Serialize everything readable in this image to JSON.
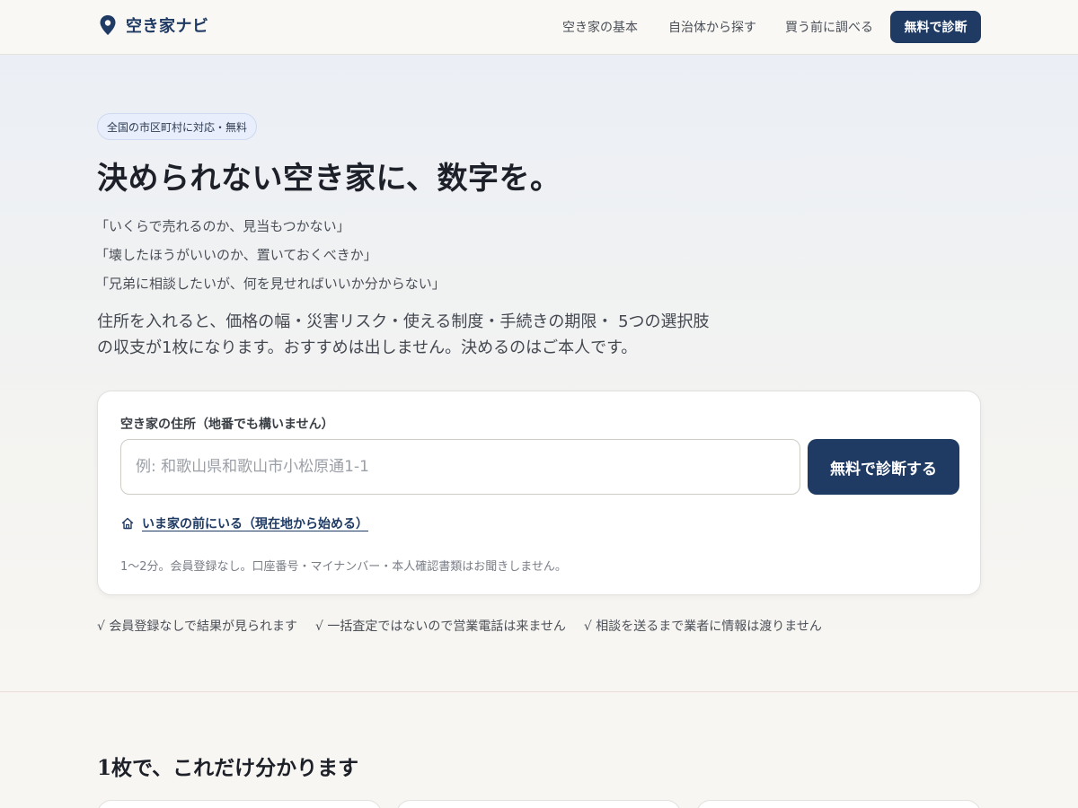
{
  "header": {
    "logo_text": "空き家ナビ",
    "nav": [
      "空き家の基本",
      "自治体から探す",
      "買う前に調べる"
    ],
    "cta_label": "無料で診断"
  },
  "hero": {
    "badge": "全国の市区町村に対応・無料",
    "title": "決められない空き家に、数字を。",
    "quotes": [
      "「いくらで売れるのか、見当もつかない」",
      "「壊したほうがいいのか、置いておくべきか」",
      "「兄弟に相談したいが、何を見せればいいか分からない」"
    ],
    "description": "住所を入れると、価格の幅・災害リスク・使える制度・手続きの期限・ 5つの選択肢の収支が1枚になります。おすすめは出しません。決めるのはご本人です。"
  },
  "form": {
    "label": "空き家の住所（地番でも構いません）",
    "placeholder": "例: 和歌山県和歌山市小松原通1-1",
    "value": "",
    "submit_label": "無料で診断する",
    "geo_link": "いま家の前にいる（現在地から始める）",
    "note": "1〜2分。会員登録なし。口座番号・マイナンバー・本人確認書類はお聞きしません。"
  },
  "trust": [
    "√ 会員登録なしで結果が見られます",
    "√ 一括査定ではないので営業電話は来ません",
    "√ 相談を送るまで業者に情報は渡りません"
  ],
  "features": {
    "title": "1枚で、これだけ分かります"
  },
  "colors": {
    "brand": "#1f3a63",
    "badge_bg": "#e8eefb"
  }
}
